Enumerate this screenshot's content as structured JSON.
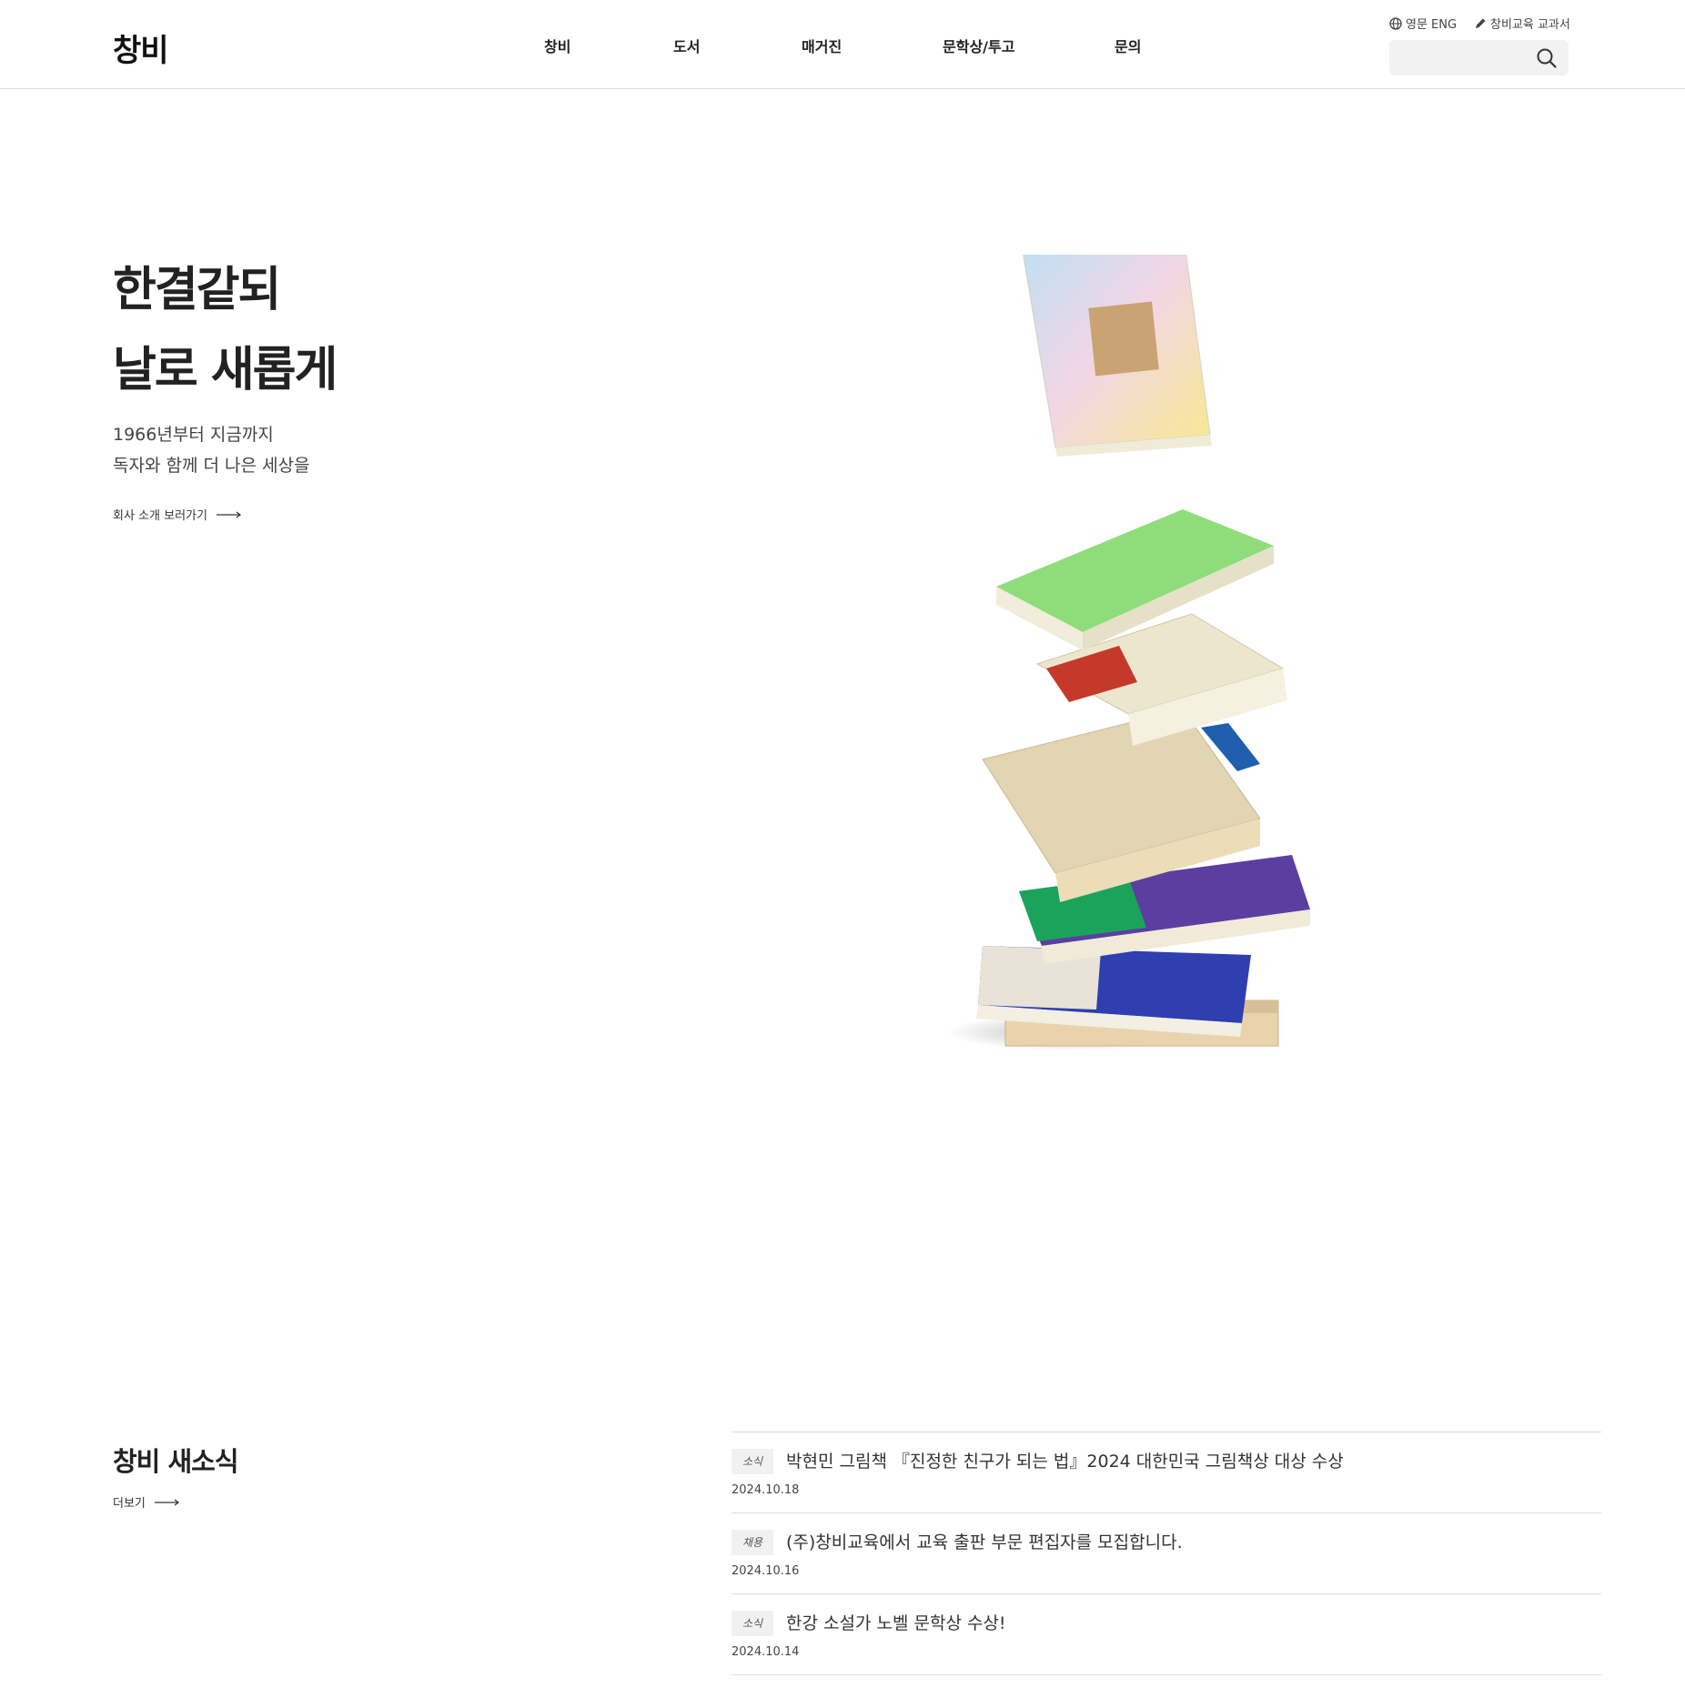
{
  "header": {
    "logo": "창비",
    "nav": [
      "창비",
      "도서",
      "매거진",
      "문학상/투고",
      "문의"
    ],
    "util_eng": "영문 ENG",
    "util_textbook": "창비교육 교과서",
    "search_placeholder": ""
  },
  "hero": {
    "title_line1": "한결같되",
    "title_line2": "날로 새롭게",
    "sub_line1": "1966년부터 지금까지",
    "sub_line2": "독자와 함께 더 나은 세상을",
    "link": "회사 소개 보러가기",
    "image_alt": "창작과비평 잡지 더미"
  },
  "news": {
    "title": "창비 새소식",
    "more": "더보기",
    "items": [
      {
        "tag": "소식",
        "text": "박현민 그림책 『진정한 친구가 되는 법』2024 대한민국 그림책상 대상 수상",
        "date": "2024.10.18"
      },
      {
        "tag": "채용",
        "text": "(주)창비교육에서 교육 출판 부문 편집자를 모집합니다.",
        "date": "2024.10.16"
      },
      {
        "tag": "소식",
        "text": "한강 소설가 노벨 문학상 수상!",
        "date": "2024.10.14"
      }
    ]
  },
  "colors": {
    "accent_green": "#16a05a",
    "magazine_green": "#8fdc7a",
    "magazine_purple": "#5b3fa0",
    "magazine_blue": "#2a3aa8"
  }
}
